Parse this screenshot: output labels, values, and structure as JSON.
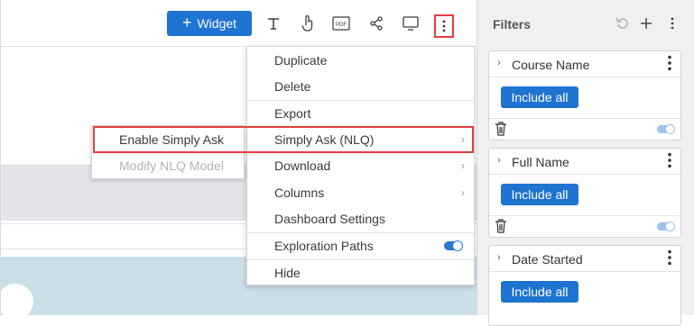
{
  "toolbar": {
    "widget_label": "Widget",
    "icons": [
      "text-icon",
      "touch-icon",
      "pdf-icon",
      "share-icon",
      "monitor-icon",
      "more-vertical-icon"
    ],
    "pdf_label": "PDF"
  },
  "menu": {
    "items": [
      {
        "label": "Duplicate"
      },
      {
        "label": "Delete"
      },
      {
        "label": "Export"
      },
      {
        "label": "Simply Ask (NLQ)",
        "submenu": true,
        "highlighted": true
      },
      {
        "label": "Download",
        "submenu": true
      },
      {
        "label": "Columns",
        "submenu": true
      },
      {
        "label": "Dashboard Settings"
      },
      {
        "label": "Exploration Paths",
        "toggle": true,
        "toggle_on": true
      },
      {
        "label": "Hide"
      }
    ]
  },
  "submenu": {
    "items": [
      {
        "label": "Enable Simply Ask",
        "enabled": true
      },
      {
        "label": "Modify NLQ Model",
        "enabled": false
      }
    ]
  },
  "filters": {
    "title": "Filters",
    "cards": [
      {
        "name": "Course Name",
        "button": "Include all",
        "toggle_on": true
      },
      {
        "name": "Full Name",
        "button": "Include all",
        "toggle_on": true
      },
      {
        "name": "Date Started",
        "button": "Include all"
      }
    ]
  },
  "colors": {
    "accent": "#1f73d1",
    "highlight": "#e0403f",
    "panel_bg": "#f0f0f2"
  }
}
